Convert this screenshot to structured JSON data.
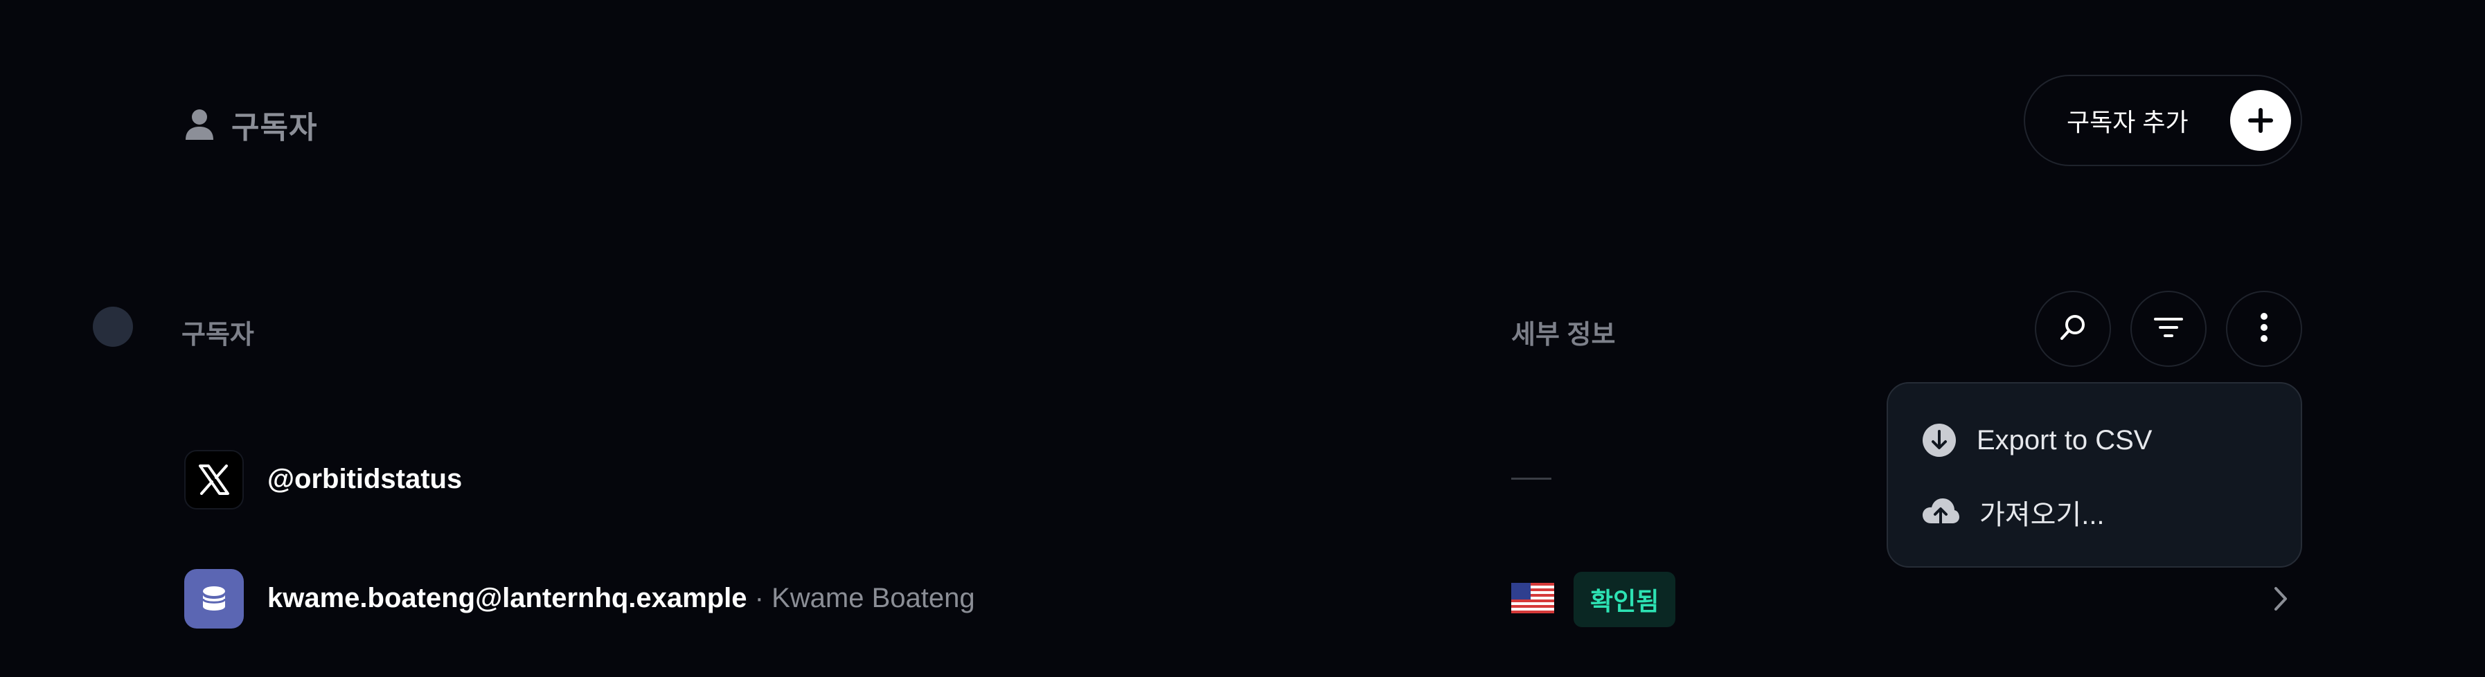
{
  "header": {
    "title": "구독자",
    "add_button_label": "구독자 추가"
  },
  "table": {
    "columns": {
      "subscriber": "구독자",
      "details": "세부 정보"
    },
    "rows": [
      {
        "avatar_icon": "x-logo-icon",
        "primary": "@orbitidstatus",
        "secondary": "",
        "details": "—"
      },
      {
        "avatar_icon": "database-icon",
        "primary": "kwame.boateng@lanternhq.example",
        "secondary": " · Kwame Boateng",
        "country_flag": "us-flag-icon",
        "status": "확인됨"
      }
    ]
  },
  "toolbar": {
    "icons": [
      "search-icon",
      "filter-icon",
      "more-vertical-icon"
    ]
  },
  "menu": {
    "items": [
      {
        "label": "Export to CSV",
        "icon": "download-circle-icon"
      },
      {
        "label": "가져오기...",
        "icon": "cloud-upload-icon"
      }
    ]
  },
  "colors": {
    "background": "#05060c",
    "badge_text": "#2de2b3",
    "badge_bg": "#0a2723",
    "avatar_accent": "#5b66b3",
    "menu_bg": "#111720"
  }
}
